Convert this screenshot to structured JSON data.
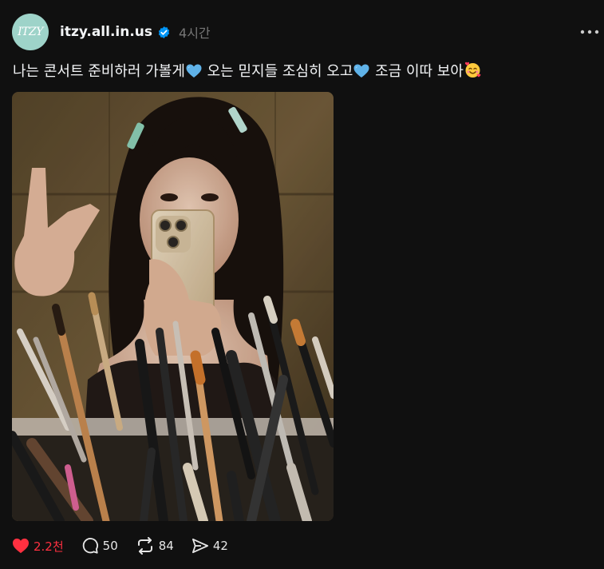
{
  "post": {
    "avatar_text": "ITZY",
    "username": "itzy.all.in.us",
    "time_ago": "4시간",
    "caption": {
      "part1": "나는 콘서트 준비하러 가볼게",
      "part2": "오는 믿지들 조심히 오고",
      "part3": "조금 이따 보아",
      "emoji_blue_heart": "blue-heart-emoji",
      "emoji_end": "smiling-face-with-hearts-emoji"
    },
    "image_icon": "mirror-selfie-photo"
  },
  "actions": {
    "likes": "2.2천",
    "comments": "50",
    "reposts": "84",
    "shares": "42"
  },
  "icons": {
    "verified": "verified-badge-icon",
    "more": "more-options-icon",
    "like": "heart-icon",
    "comment": "comment-icon",
    "repost": "repost-icon",
    "share": "share-icon"
  },
  "colors": {
    "background": "#101010",
    "text": "#f3f5f7",
    "muted": "#777777",
    "like_red": "#ff3040",
    "verified_blue": "#0095f6",
    "avatar_bg": "#9ed3c9"
  }
}
